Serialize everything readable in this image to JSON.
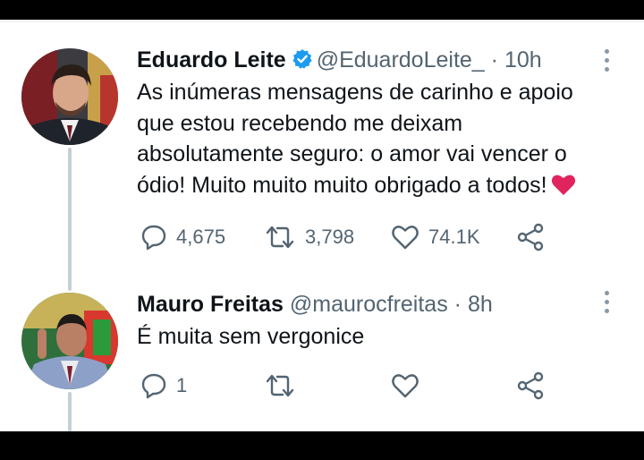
{
  "tweets": [
    {
      "name": "Eduardo Leite",
      "handle": "@EduardoLeite_",
      "separator": "·",
      "time": "10h",
      "verified": true,
      "text_lines": [
        "As inúmeras mensagens de carinho e apoio",
        "que estou recebendo me deixam",
        "absolutamente seguro: o amor vai vencer o",
        "ódio! Muito muito muito obrigado a todos!"
      ],
      "emoji": "red-heart",
      "replies": "4,675",
      "retweets": "3,798",
      "likes": "74.1K"
    },
    {
      "name": "Mauro Freitas",
      "handle": "@maurocfreitas",
      "separator": "·",
      "time": "8h",
      "verified": false,
      "text_lines": [
        "É muita sem vergonice"
      ],
      "replies": "1",
      "retweets": "",
      "likes": ""
    }
  ],
  "icons": [
    "verified-badge-icon",
    "more-options-icon",
    "reply-icon",
    "retweet-icon",
    "like-icon",
    "share-icon",
    "red-heart-emoji"
  ],
  "colors": {
    "text": "#0f1419",
    "secondary": "#536471",
    "verified": "#1d9bf0",
    "heart": "#e0245e",
    "thread_line": "#c4cfd6"
  }
}
